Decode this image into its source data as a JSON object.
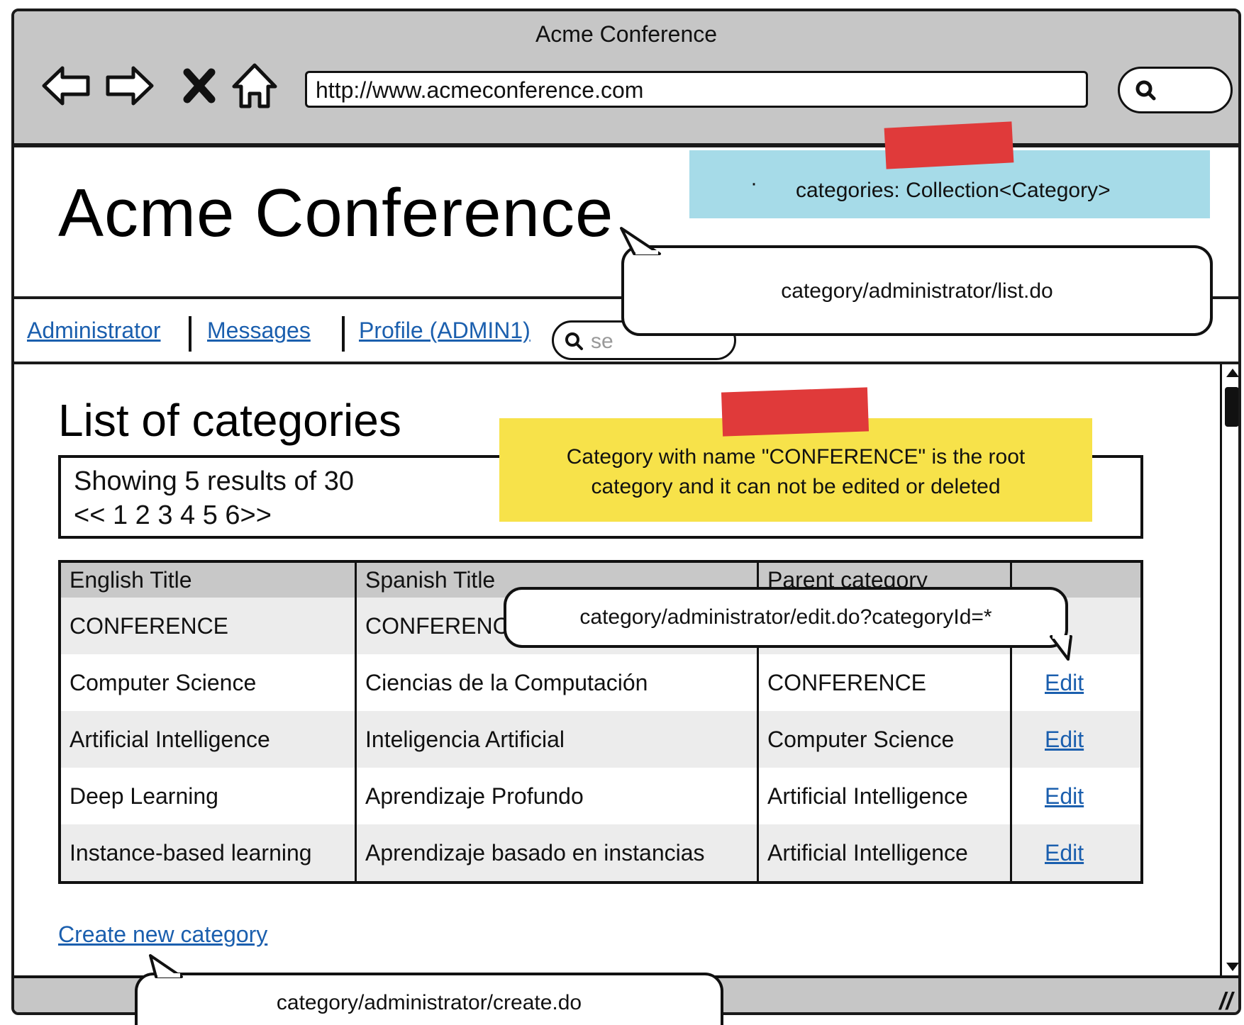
{
  "window": {
    "title": "Acme Conference",
    "url": "http://www.acmeconference.com"
  },
  "header": {
    "site_title": "Acme Conference"
  },
  "menu": {
    "items": [
      {
        "label": "Administrator"
      },
      {
        "label": "Messages"
      },
      {
        "label": "Profile (ADMIN1)"
      }
    ],
    "search_placeholder": "se"
  },
  "main": {
    "title": "List of categories",
    "pager": {
      "count_text": "Showing 5 results of 30",
      "pages_text": "<< 1 2 3 4 5 6>>"
    },
    "table": {
      "headers": [
        "English Title",
        "Spanish Title",
        "Parent category",
        ""
      ],
      "rows": [
        {
          "english": "CONFERENCE",
          "spanish": "CONFERENCE",
          "parent": "",
          "action": ""
        },
        {
          "english": "Computer Science",
          "spanish": "Ciencias de la Computación",
          "parent": "CONFERENCE",
          "action": "Edit"
        },
        {
          "english": "Artificial Intelligence",
          "spanish": "Inteligencia Artificial",
          "parent": "Computer Science",
          "action": "Edit"
        },
        {
          "english": "Deep Learning",
          "spanish": "Aprendizaje Profundo",
          "parent": "Artificial Intelligence",
          "action": "Edit"
        },
        {
          "english": "Instance-based learning",
          "spanish": "Aprendizaje basado en instancias",
          "parent": "Artificial Intelligence",
          "action": "Edit"
        }
      ]
    },
    "create_link": "Create new category"
  },
  "annotations": {
    "model_note": "categories: Collection<Category>",
    "bullet": "·",
    "root_note_line1": "Category with name \"CONFERENCE\" is the root",
    "root_note_line2": "category and it can not be edited or deleted",
    "list_url": "category/administrator/list.do",
    "edit_url": "category/administrator/edit.do?categoryId=*",
    "create_url": "category/administrator/create.do"
  },
  "colors": {
    "link": "#1b5fae",
    "chrome": "#c6c6c6",
    "sticky_blue": "#a6dbe8",
    "sticky_yellow": "#f7e24a",
    "tape": "#e03a3a"
  }
}
